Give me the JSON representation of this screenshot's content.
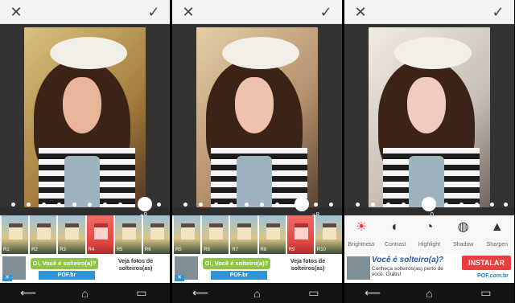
{
  "screens": [
    {
      "top_icons": {
        "close": "close-icon",
        "confirm": "checkmark-icon"
      },
      "value_label": "+9",
      "filters": [
        "R1",
        "R2",
        "R3",
        "R4",
        "R5",
        "R6"
      ],
      "highlight_filter": "R4",
      "ad": {
        "title": "Oi, Você é solteiro(a)?",
        "button": "POF.br",
        "right_text": "Veja fotos de solteiros(as)"
      }
    },
    {
      "top_icons": {
        "close": "close-icon",
        "confirm": "checkmark-icon"
      },
      "value_label": "+8",
      "filters": [
        "R5",
        "R6",
        "R7",
        "R8",
        "R9",
        "R10"
      ],
      "highlight_filter": "R9",
      "ad": {
        "title": "Oi, Você é solteiro(a)?",
        "button": "POF.br",
        "right_text": "Veja fotos de solteiros(as)"
      }
    },
    {
      "top_icons": {
        "close": "close-icon",
        "confirm": "checkmark-icon"
      },
      "value_label": "0",
      "tools": [
        {
          "label": "Brightness",
          "icon": "sun-icon",
          "active": true
        },
        {
          "label": "Contrast",
          "icon": "contrast-icon",
          "active": false
        },
        {
          "label": "Highlight",
          "icon": "highlight-icon",
          "active": false
        },
        {
          "label": "Shadow",
          "icon": "shadow-icon",
          "active": false
        },
        {
          "label": "Sharpen",
          "icon": "triangle-icon",
          "active": false
        }
      ],
      "ad": {
        "headline": "Você é solteiro(a)?",
        "subline": "Conheça solteiros(as) perto de você. Grátis!",
        "button": "INSTALAR",
        "url": "POF.com.br"
      }
    }
  ],
  "colors": {
    "accent_red": "#e24742",
    "ad_green": "#8ec447",
    "ad_blue": "#2f95d7",
    "install_red": "#ea3f3f"
  }
}
